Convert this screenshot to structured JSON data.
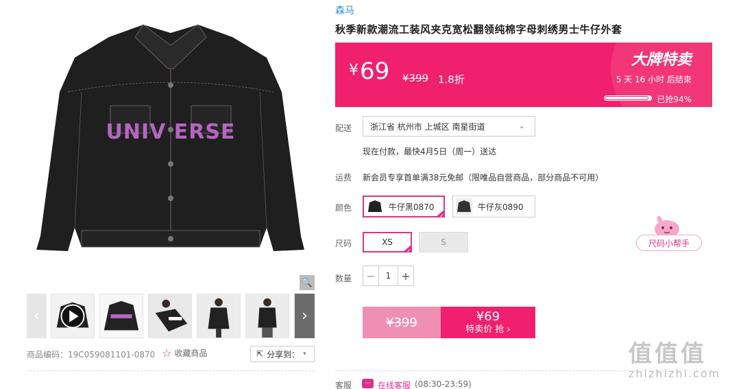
{
  "product": {
    "brand": "森马",
    "title": "秋季新款潮流工装风夹克宽松翻领纯棉字母刺绣男士牛仔外套",
    "image_text": "UNIV ERSE",
    "sku_code": "商品编码：19C059081101-0870",
    "favorite_label": "收藏商品",
    "share_label": "分享到："
  },
  "price": {
    "currency": "¥",
    "current": "69",
    "original": "¥399",
    "discount": "1.8折",
    "sale_title": "大牌特卖",
    "countdown": "5  天  16  小时  后结束",
    "sold_percent": 94,
    "sold_label": "已抢94%"
  },
  "delivery": {
    "label": "配送",
    "address": "浙江省 杭州市 上城区 南星街道",
    "note": "现在付款，最快4月5日（周一）送达"
  },
  "fee": {
    "label": "运费",
    "text": "新会员专享首单满38元免邮（限唯品自营商品，部分商品不可用）"
  },
  "colors": {
    "label": "颜色",
    "options": [
      "牛仔黑0870",
      "牛仔灰0890"
    ],
    "selected": "牛仔黑0870"
  },
  "sizes": {
    "label": "尺码",
    "options": [
      "XS",
      "S"
    ],
    "selected": "XS"
  },
  "size_helper": "尺码小帮手",
  "quantity": {
    "label": "数量",
    "value": "1",
    "minus": "−",
    "plus": "+"
  },
  "buy": {
    "original": "¥399",
    "price": "¥69",
    "label": "特卖价 抢 ›"
  },
  "service": {
    "label": "客服",
    "link": "在线客服",
    "hours": "(08:30-23:59)",
    "icon_text": "···"
  },
  "watermark": {
    "big": "值值值",
    "small": "zhizhizhi.com"
  },
  "colors_theme": {
    "accent": "#f0206e",
    "brand_blue": "#2e8fdd",
    "selected_border": "#d9328a"
  }
}
